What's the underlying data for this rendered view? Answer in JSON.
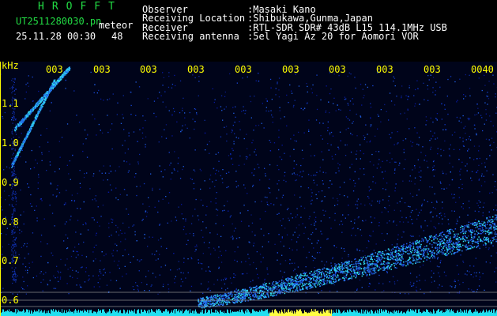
{
  "header": {
    "brand": "HROFFT",
    "filename": "UT2511280030.pn",
    "datetime": "25.11.28 00:30",
    "meteor_label": "meteor",
    "meteor_count": "48",
    "rows": [
      {
        "label": "Observer",
        "value": ":Masaki Kano"
      },
      {
        "label": "Receiving Location",
        "value": ":Shibukawa,Gunma,Japan"
      },
      {
        "label": "Receiver",
        "value": ":RTL-SDR SDR# 43dB L15 114.1MHz USB"
      },
      {
        "label": "Receiving antenna",
        "value": ":5el Yagi Az 20 for Aomori VOR"
      }
    ]
  },
  "plot": {
    "y_unit": "kHz",
    "y_ticks": [
      "1.1",
      "1.0",
      "0.9",
      "0.8",
      "0.7",
      "0.6"
    ],
    "x_ticks": [
      "003",
      "003",
      "003",
      "003",
      "003",
      "003",
      "003",
      "003",
      "003",
      "0040"
    ],
    "colors": {
      "background": "#00041a",
      "signal": "#00e0ff",
      "noise": "#1030c0",
      "axis": "#ffff00"
    }
  }
}
